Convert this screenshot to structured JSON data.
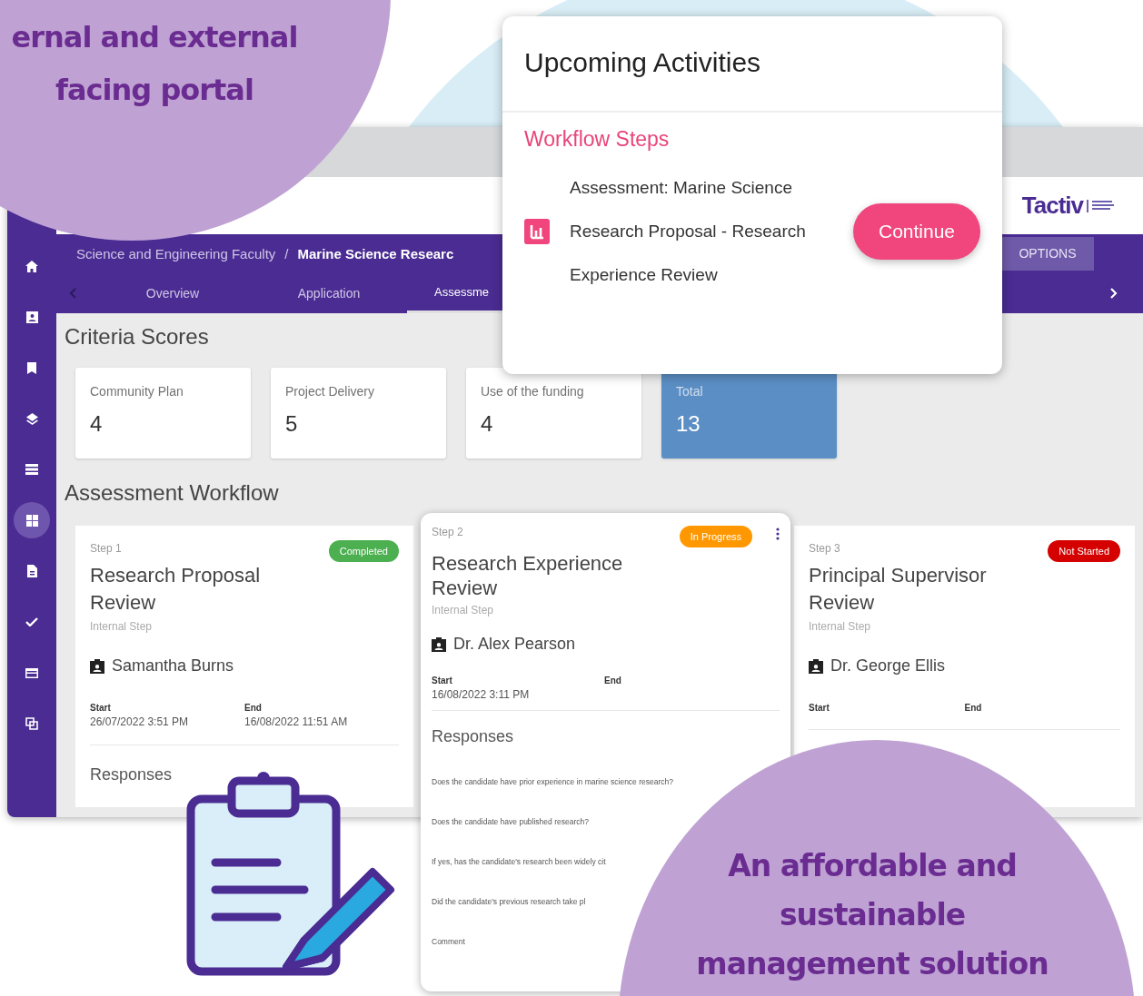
{
  "promo_top": {
    "heading": "ernal and external facing portal"
  },
  "promo_bottom": {
    "heading": "An affordable and sustainable management solution"
  },
  "app": {
    "logo": {
      "text": "Tactiv"
    },
    "sidebar": {
      "items": [
        {
          "kind": "home",
          "selected": false
        },
        {
          "kind": "person",
          "selected": false
        },
        {
          "kind": "bookmark",
          "selected": false
        },
        {
          "kind": "layers",
          "selected": false
        },
        {
          "kind": "list",
          "selected": false
        },
        {
          "kind": "grid",
          "selected": true
        },
        {
          "kind": "file",
          "selected": false
        },
        {
          "kind": "check",
          "selected": false
        },
        {
          "kind": "card",
          "selected": false
        },
        {
          "kind": "copy",
          "selected": false
        }
      ]
    },
    "breadcrumb": {
      "parent": "Science and Engineering Faculty",
      "separator": "/",
      "current": "Marine Science Researc"
    },
    "options_button": "OPTIONS",
    "tabs": [
      {
        "label": "Overview",
        "selected": false
      },
      {
        "label": "Application",
        "selected": false
      },
      {
        "label": "Assessme",
        "selected": true
      }
    ],
    "criteria": {
      "title": "Criteria Scores",
      "scores": [
        {
          "kind": "score",
          "label": "Community Plan",
          "value": "4"
        },
        {
          "kind": "score",
          "label": "Project Delivery",
          "value": "5"
        },
        {
          "kind": "score",
          "label": "Use of the funding",
          "value": "4"
        },
        {
          "kind": "total",
          "label": "Total",
          "value": "13"
        }
      ]
    },
    "workflow": {
      "title": "Assessment Workflow",
      "steps": [
        {
          "step": "Step 1",
          "title": "Research Proposal Review",
          "subtitle": "Internal Step",
          "kind": "completed",
          "status_label": "Completed",
          "assignee": "Samantha Burns",
          "start_label": "Start",
          "start": "26/07/2022 3:51 PM",
          "end_label": "End",
          "end": "16/08/2022 11:51 AM",
          "responses_title": "Responses"
        },
        {
          "step": "Step 2",
          "title": "Research Experience Review",
          "subtitle": "Internal Step",
          "kind": "in_progress",
          "status_label": "In Progress",
          "assignee": "Dr. Alex Pearson",
          "start_label": "Start",
          "start": "16/08/2022 3:11 PM",
          "end_label": "End",
          "responses_title": "Responses",
          "questions": [
            "Does the candidate have prior experience in marine science research?",
            "Does the candidate have published research?",
            "If yes, has the candidate's research been widely cit",
            "Did the candidate's previous research take pl",
            "Comment"
          ]
        },
        {
          "step": "Step 3",
          "title": "Principal Supervisor Review",
          "subtitle": "Internal Step",
          "kind": "not_started",
          "status_label": "Not Started",
          "assignee": "Dr. George Ellis",
          "start_label": "Start",
          "end_label": "End"
        }
      ]
    }
  },
  "popup": {
    "title": "Upcoming Activities",
    "section": "Workflow Steps",
    "activity": "Assessment: Marine Science Research Proposal - Research Experience Review",
    "button": "Continue"
  }
}
